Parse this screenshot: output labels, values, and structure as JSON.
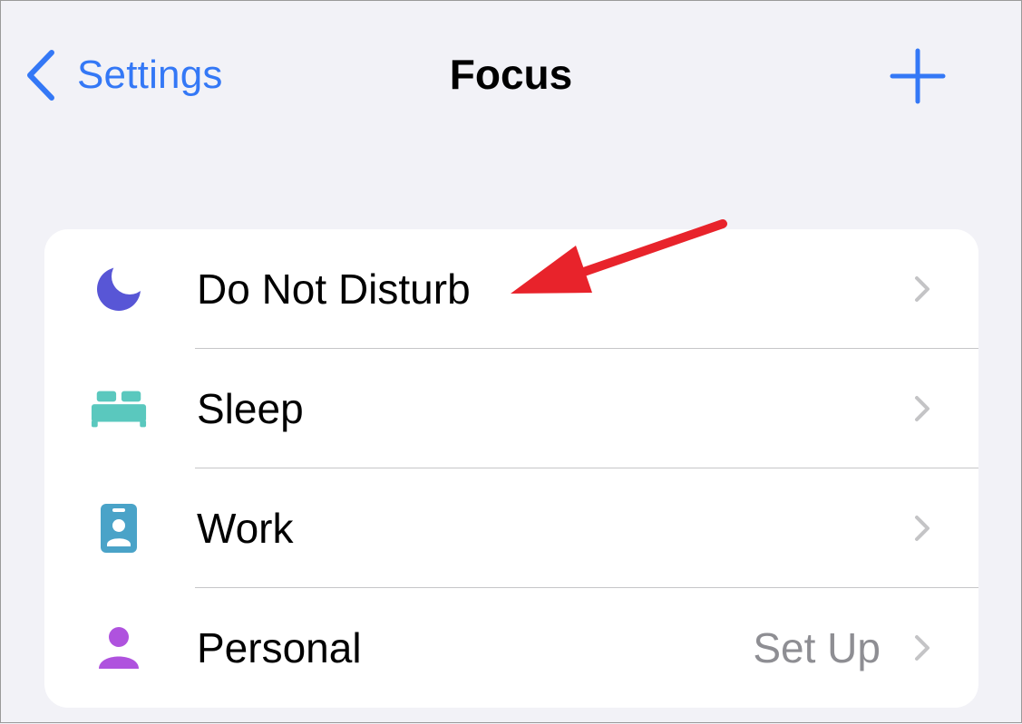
{
  "nav": {
    "back_label": "Settings",
    "title": "Focus"
  },
  "focus_list": [
    {
      "label": "Do Not Disturb",
      "icon": "moon-icon",
      "color": "#5856d6",
      "detail": ""
    },
    {
      "label": "Sleep",
      "icon": "bed-icon",
      "color": "#5ac8be",
      "detail": ""
    },
    {
      "label": "Work",
      "icon": "id-badge-icon",
      "color": "#4aa3c8",
      "detail": ""
    },
    {
      "label": "Personal",
      "icon": "person-icon",
      "color": "#af52de",
      "detail": "Set Up"
    }
  ],
  "colors": {
    "accent": "#3478f6",
    "annotation": "#e8232b",
    "background": "#f2f2f7",
    "chevron": "#c4c4c6"
  }
}
